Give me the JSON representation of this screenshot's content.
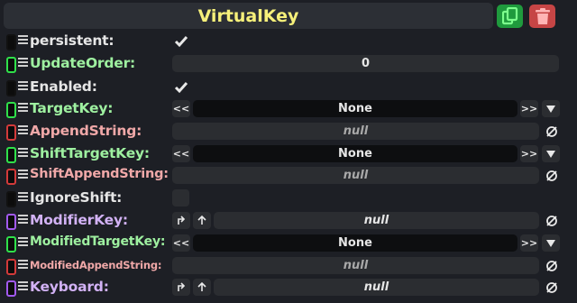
{
  "component": {
    "title": "VirtualKey"
  },
  "header": {
    "duplicate_icon": "copy-icon",
    "delete_icon": "trash-icon"
  },
  "colors": {
    "title": "#f6f07a",
    "handle_black": "#0c0c0c",
    "handle_green": "#2fe04a",
    "handle_red": "#d33a3a",
    "handle_purple": "#a25af0",
    "label_white": "#e6e6e6",
    "label_green": "#9ef0a0",
    "label_pink": "#f0a8a8",
    "label_purple": "#d2b2f5"
  },
  "fields": {
    "persistent": {
      "label": "persistent:",
      "checked": true
    },
    "update_order": {
      "label": "UpdateOrder:",
      "value": "0"
    },
    "enabled": {
      "label": "Enabled:",
      "checked": true
    },
    "target_key": {
      "label": "TargetKey:",
      "value": "None",
      "prev": "<<",
      "next": ">>"
    },
    "append_string": {
      "label": "AppendString:",
      "value": "null"
    },
    "shift_target_key": {
      "label": "ShiftTargetKey:",
      "value": "None",
      "prev": "<<",
      "next": ">>"
    },
    "shift_append_string": {
      "label": "ShiftAppendString:",
      "value": "null"
    },
    "ignore_shift": {
      "label": "IgnoreShift:",
      "checked": false
    },
    "modifier_key": {
      "label": "ModifierKey:",
      "value": "null"
    },
    "modified_target_key": {
      "label": "ModifiedTargetKey:",
      "value": "None",
      "prev": "<<",
      "next": ">>"
    },
    "modified_append_string": {
      "label": "ModifiedAppendString:",
      "value": "null"
    },
    "keyboard": {
      "label": "Keyboard:",
      "value": "null"
    }
  }
}
